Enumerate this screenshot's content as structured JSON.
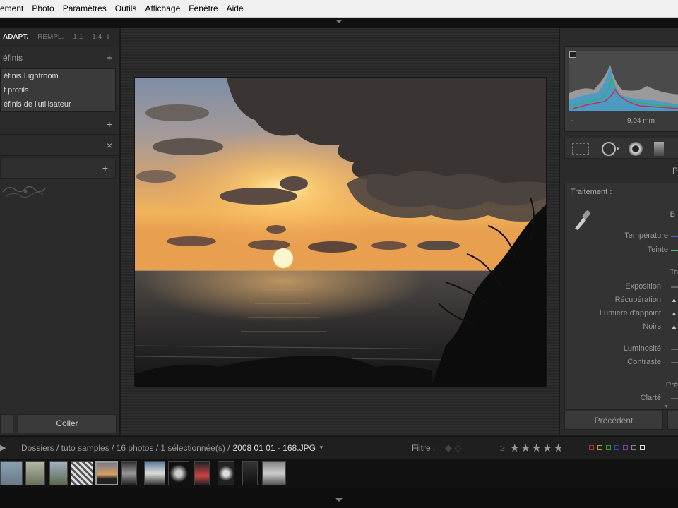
{
  "menubar": {
    "items": [
      "ement",
      "Photo",
      "Paramètres",
      "Outils",
      "Affichage",
      "Fenêtre",
      "Aide"
    ]
  },
  "left_panel": {
    "zoom_modes": [
      "ADAPT.",
      "REMPL.",
      "1:1",
      "1:4"
    ],
    "presets_header": "éfinis",
    "preset_items": [
      "éfinis Lightroom",
      "t profils",
      "éfinis de l'utilisateur"
    ],
    "copy_button": "",
    "paste_button": "Coller"
  },
  "right_panel": {
    "histogram_info": "9,04 mm",
    "treatment_label": "Traitement :",
    "treatment_value": "B",
    "section_partial_1": "P",
    "wb_sliders": [
      "Température",
      "Teinte"
    ],
    "tone_header": "To",
    "tone_sliders": [
      "Exposition",
      "Récupération",
      "Lumière d'appoint",
      "Noirs"
    ],
    "tone_sliders_2": [
      "Luminosité",
      "Contraste"
    ],
    "presence_header": "Pré",
    "presence_sliders": [
      "Clarté"
    ],
    "previous_button": "Précédent"
  },
  "filmbar": {
    "breadcrumb": "Dossiers / tuto samples / 16 photos / 1 sélectionnée(s) /",
    "filename": "2008 01 01 - 168.JPG",
    "filter_label": "Filtre :",
    "stars": "★★★★★",
    "color_labels": [
      "#b03030",
      "#b0a030",
      "#30a030",
      "#3050b0",
      "#8040a0",
      "#888888",
      "#dddddd"
    ]
  },
  "icons": {
    "plus": "+",
    "close": "×",
    "arrow_right": "▶",
    "dropdown": "▼"
  }
}
